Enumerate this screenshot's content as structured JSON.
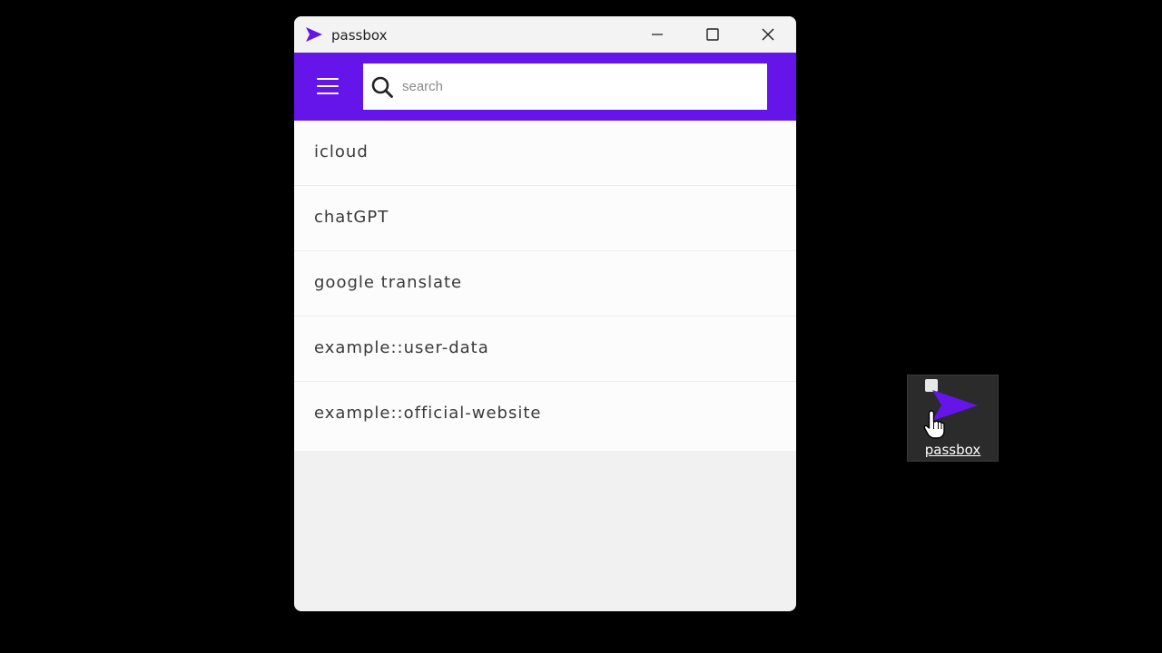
{
  "window": {
    "title": "passbox",
    "controls": [
      "minimize",
      "maximize",
      "close"
    ]
  },
  "appbar": {
    "menu_icon": "hamburger-menu-icon",
    "search": {
      "placeholder": "search",
      "value": "",
      "icon": "search-icon"
    }
  },
  "entries": [
    {
      "label": "icloud"
    },
    {
      "label": "chatGPT"
    },
    {
      "label": "google translate"
    },
    {
      "label": "example::user-data"
    },
    {
      "label": "example::official-website"
    }
  ],
  "desktop_shortcut": {
    "label": "passbox",
    "icon": "passbox-logo-icon"
  },
  "colors": {
    "accent": "#6514ea",
    "background": "#000000",
    "list_background": "#fcfcfc"
  }
}
